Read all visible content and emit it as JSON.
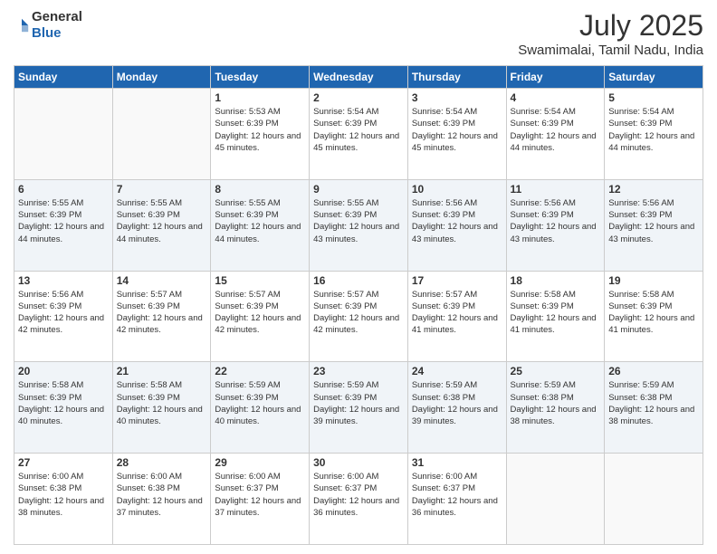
{
  "header": {
    "logo_general": "General",
    "logo_blue": "Blue",
    "title": "July 2025",
    "subtitle": "Swamimalai, Tamil Nadu, India"
  },
  "days_of_week": [
    "Sunday",
    "Monday",
    "Tuesday",
    "Wednesday",
    "Thursday",
    "Friday",
    "Saturday"
  ],
  "weeks": [
    [
      {
        "day": "",
        "sunrise": "",
        "sunset": "",
        "daylight": ""
      },
      {
        "day": "",
        "sunrise": "",
        "sunset": "",
        "daylight": ""
      },
      {
        "day": "1",
        "sunrise": "Sunrise: 5:53 AM",
        "sunset": "Sunset: 6:39 PM",
        "daylight": "Daylight: 12 hours and 45 minutes."
      },
      {
        "day": "2",
        "sunrise": "Sunrise: 5:54 AM",
        "sunset": "Sunset: 6:39 PM",
        "daylight": "Daylight: 12 hours and 45 minutes."
      },
      {
        "day": "3",
        "sunrise": "Sunrise: 5:54 AM",
        "sunset": "Sunset: 6:39 PM",
        "daylight": "Daylight: 12 hours and 45 minutes."
      },
      {
        "day": "4",
        "sunrise": "Sunrise: 5:54 AM",
        "sunset": "Sunset: 6:39 PM",
        "daylight": "Daylight: 12 hours and 44 minutes."
      },
      {
        "day": "5",
        "sunrise": "Sunrise: 5:54 AM",
        "sunset": "Sunset: 6:39 PM",
        "daylight": "Daylight: 12 hours and 44 minutes."
      }
    ],
    [
      {
        "day": "6",
        "sunrise": "Sunrise: 5:55 AM",
        "sunset": "Sunset: 6:39 PM",
        "daylight": "Daylight: 12 hours and 44 minutes."
      },
      {
        "day": "7",
        "sunrise": "Sunrise: 5:55 AM",
        "sunset": "Sunset: 6:39 PM",
        "daylight": "Daylight: 12 hours and 44 minutes."
      },
      {
        "day": "8",
        "sunrise": "Sunrise: 5:55 AM",
        "sunset": "Sunset: 6:39 PM",
        "daylight": "Daylight: 12 hours and 44 minutes."
      },
      {
        "day": "9",
        "sunrise": "Sunrise: 5:55 AM",
        "sunset": "Sunset: 6:39 PM",
        "daylight": "Daylight: 12 hours and 43 minutes."
      },
      {
        "day": "10",
        "sunrise": "Sunrise: 5:56 AM",
        "sunset": "Sunset: 6:39 PM",
        "daylight": "Daylight: 12 hours and 43 minutes."
      },
      {
        "day": "11",
        "sunrise": "Sunrise: 5:56 AM",
        "sunset": "Sunset: 6:39 PM",
        "daylight": "Daylight: 12 hours and 43 minutes."
      },
      {
        "day": "12",
        "sunrise": "Sunrise: 5:56 AM",
        "sunset": "Sunset: 6:39 PM",
        "daylight": "Daylight: 12 hours and 43 minutes."
      }
    ],
    [
      {
        "day": "13",
        "sunrise": "Sunrise: 5:56 AM",
        "sunset": "Sunset: 6:39 PM",
        "daylight": "Daylight: 12 hours and 42 minutes."
      },
      {
        "day": "14",
        "sunrise": "Sunrise: 5:57 AM",
        "sunset": "Sunset: 6:39 PM",
        "daylight": "Daylight: 12 hours and 42 minutes."
      },
      {
        "day": "15",
        "sunrise": "Sunrise: 5:57 AM",
        "sunset": "Sunset: 6:39 PM",
        "daylight": "Daylight: 12 hours and 42 minutes."
      },
      {
        "day": "16",
        "sunrise": "Sunrise: 5:57 AM",
        "sunset": "Sunset: 6:39 PM",
        "daylight": "Daylight: 12 hours and 42 minutes."
      },
      {
        "day": "17",
        "sunrise": "Sunrise: 5:57 AM",
        "sunset": "Sunset: 6:39 PM",
        "daylight": "Daylight: 12 hours and 41 minutes."
      },
      {
        "day": "18",
        "sunrise": "Sunrise: 5:58 AM",
        "sunset": "Sunset: 6:39 PM",
        "daylight": "Daylight: 12 hours and 41 minutes."
      },
      {
        "day": "19",
        "sunrise": "Sunrise: 5:58 AM",
        "sunset": "Sunset: 6:39 PM",
        "daylight": "Daylight: 12 hours and 41 minutes."
      }
    ],
    [
      {
        "day": "20",
        "sunrise": "Sunrise: 5:58 AM",
        "sunset": "Sunset: 6:39 PM",
        "daylight": "Daylight: 12 hours and 40 minutes."
      },
      {
        "day": "21",
        "sunrise": "Sunrise: 5:58 AM",
        "sunset": "Sunset: 6:39 PM",
        "daylight": "Daylight: 12 hours and 40 minutes."
      },
      {
        "day": "22",
        "sunrise": "Sunrise: 5:59 AM",
        "sunset": "Sunset: 6:39 PM",
        "daylight": "Daylight: 12 hours and 40 minutes."
      },
      {
        "day": "23",
        "sunrise": "Sunrise: 5:59 AM",
        "sunset": "Sunset: 6:39 PM",
        "daylight": "Daylight: 12 hours and 39 minutes."
      },
      {
        "day": "24",
        "sunrise": "Sunrise: 5:59 AM",
        "sunset": "Sunset: 6:38 PM",
        "daylight": "Daylight: 12 hours and 39 minutes."
      },
      {
        "day": "25",
        "sunrise": "Sunrise: 5:59 AM",
        "sunset": "Sunset: 6:38 PM",
        "daylight": "Daylight: 12 hours and 38 minutes."
      },
      {
        "day": "26",
        "sunrise": "Sunrise: 5:59 AM",
        "sunset": "Sunset: 6:38 PM",
        "daylight": "Daylight: 12 hours and 38 minutes."
      }
    ],
    [
      {
        "day": "27",
        "sunrise": "Sunrise: 6:00 AM",
        "sunset": "Sunset: 6:38 PM",
        "daylight": "Daylight: 12 hours and 38 minutes."
      },
      {
        "day": "28",
        "sunrise": "Sunrise: 6:00 AM",
        "sunset": "Sunset: 6:38 PM",
        "daylight": "Daylight: 12 hours and 37 minutes."
      },
      {
        "day": "29",
        "sunrise": "Sunrise: 6:00 AM",
        "sunset": "Sunset: 6:37 PM",
        "daylight": "Daylight: 12 hours and 37 minutes."
      },
      {
        "day": "30",
        "sunrise": "Sunrise: 6:00 AM",
        "sunset": "Sunset: 6:37 PM",
        "daylight": "Daylight: 12 hours and 36 minutes."
      },
      {
        "day": "31",
        "sunrise": "Sunrise: 6:00 AM",
        "sunset": "Sunset: 6:37 PM",
        "daylight": "Daylight: 12 hours and 36 minutes."
      },
      {
        "day": "",
        "sunrise": "",
        "sunset": "",
        "daylight": ""
      },
      {
        "day": "",
        "sunrise": "",
        "sunset": "",
        "daylight": ""
      }
    ]
  ]
}
